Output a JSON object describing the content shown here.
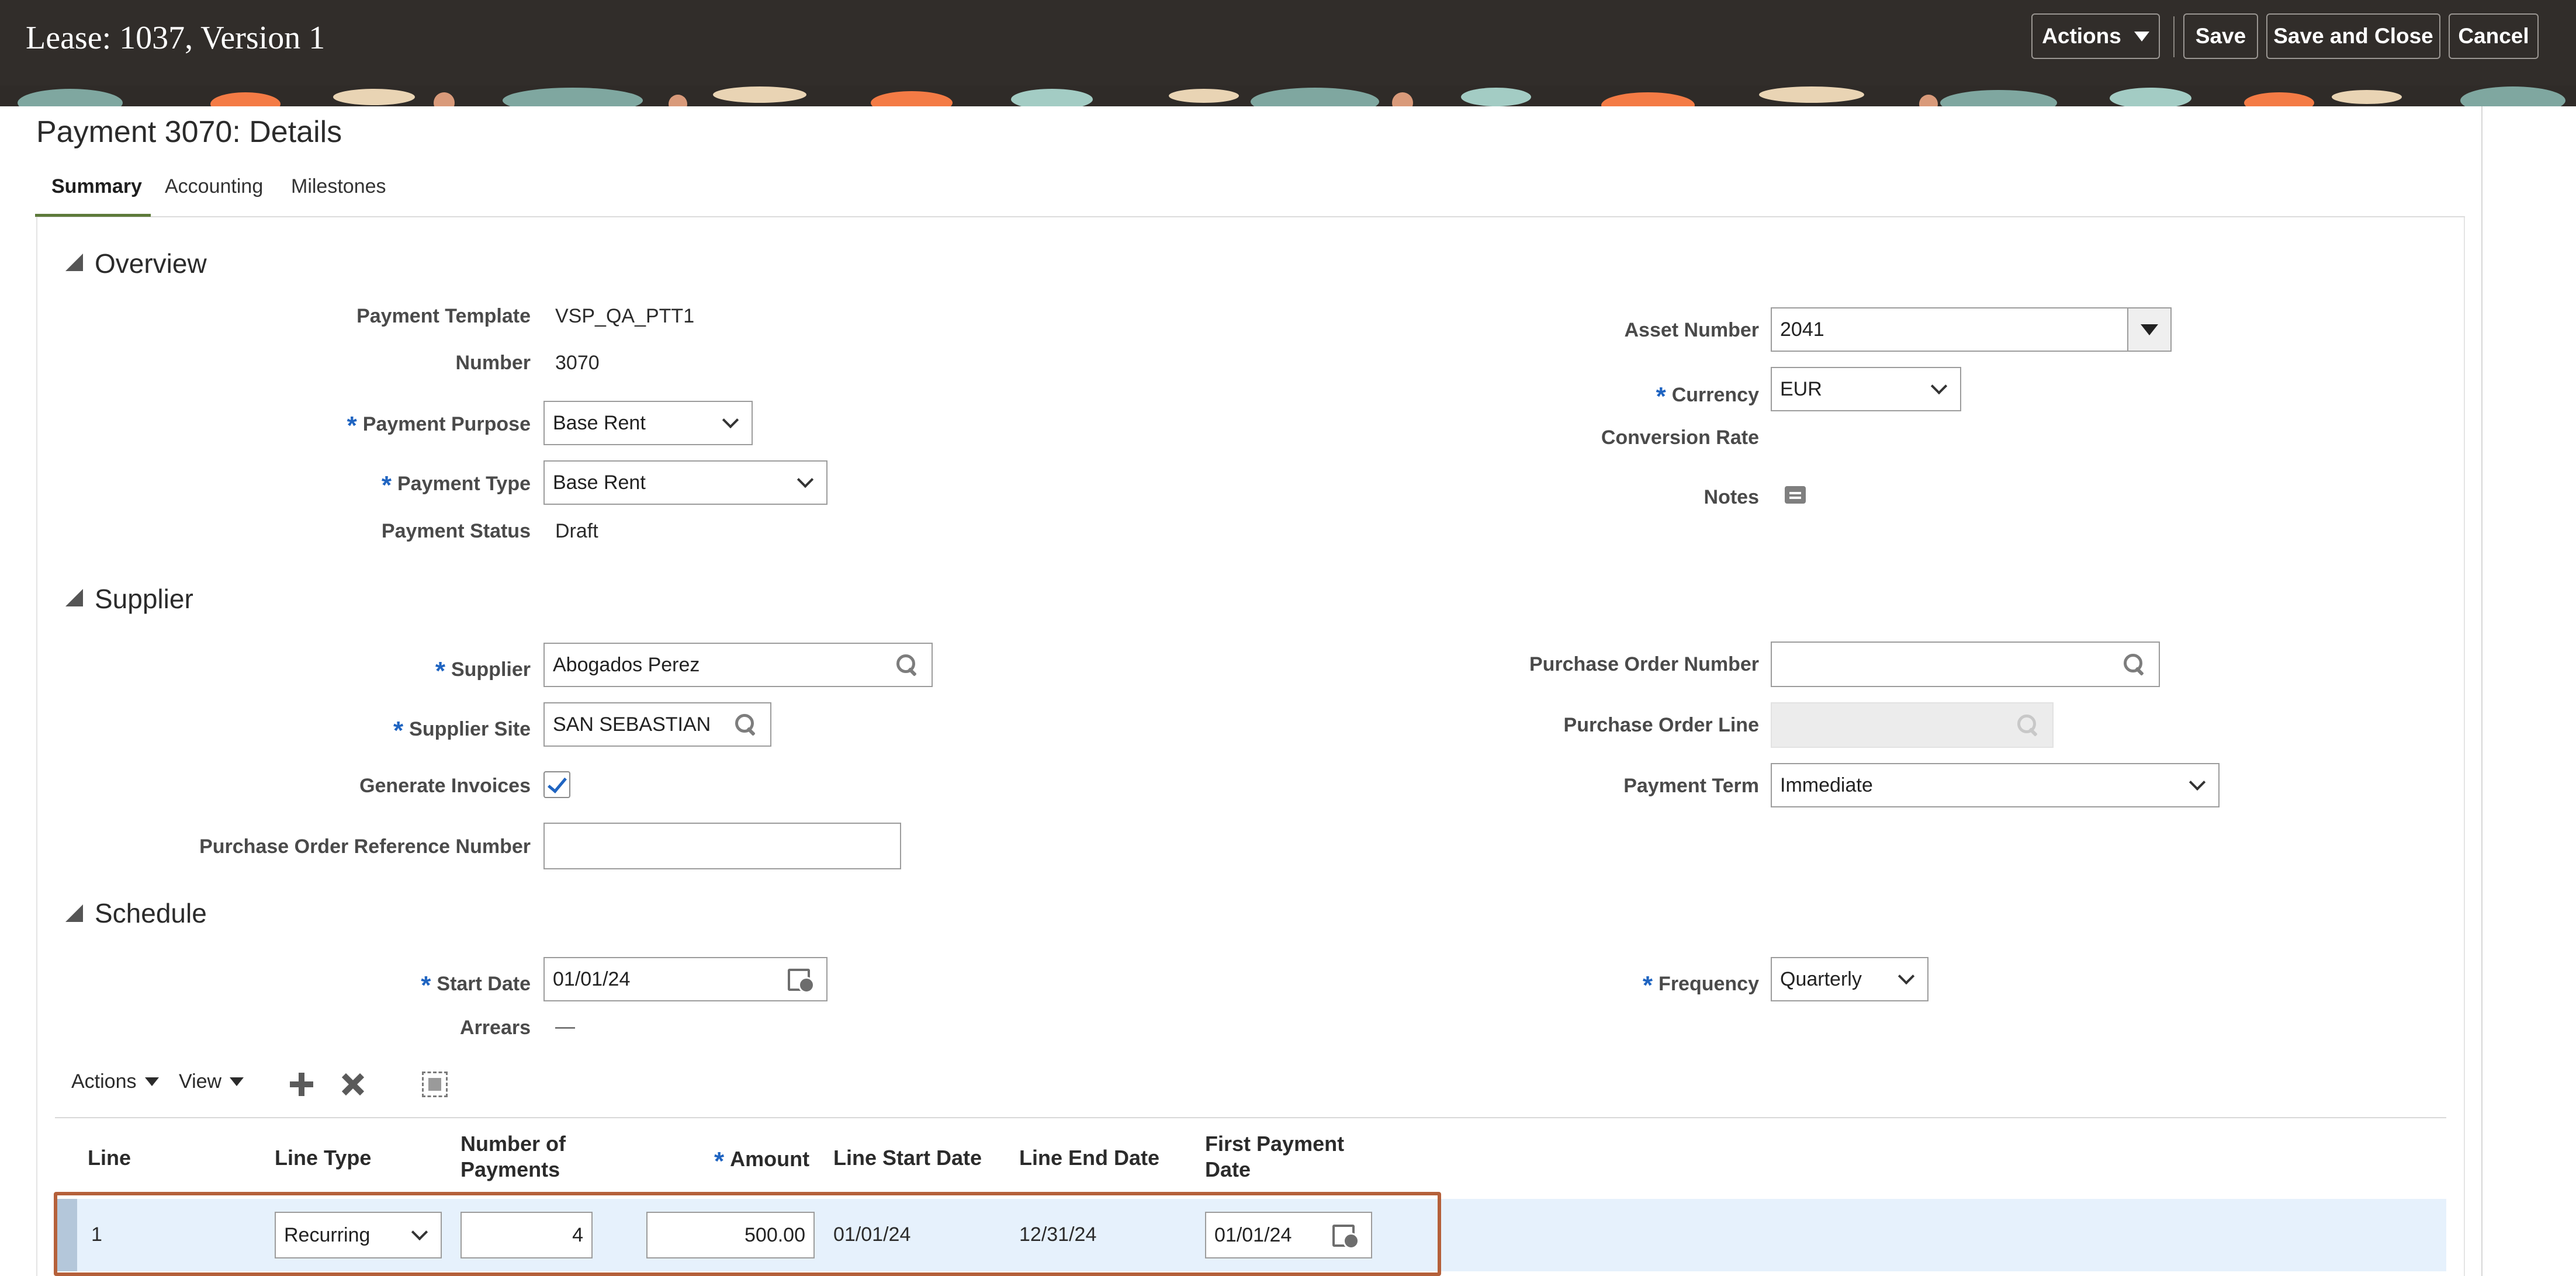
{
  "header": {
    "title": "Lease: 1037, Version 1",
    "actions_label": "Actions",
    "save_label": "Save",
    "save_close_label": "Save and Close",
    "cancel_label": "Cancel"
  },
  "page": {
    "title": "Payment 3070: Details",
    "tabs": [
      {
        "label": "Summary",
        "active": true
      },
      {
        "label": "Accounting",
        "active": false
      },
      {
        "label": "Milestones",
        "active": false
      }
    ]
  },
  "overview": {
    "title": "Overview",
    "payment_template": {
      "label": "Payment Template",
      "value": "VSP_QA_PTT1"
    },
    "number": {
      "label": "Number",
      "value": "3070"
    },
    "payment_purpose": {
      "label": "Payment Purpose",
      "value": "Base Rent",
      "required": true
    },
    "payment_type": {
      "label": "Payment Type",
      "value": "Base Rent",
      "required": true
    },
    "payment_status": {
      "label": "Payment Status",
      "value": "Draft"
    },
    "asset_number": {
      "label": "Asset Number",
      "value": "2041"
    },
    "currency": {
      "label": "Currency",
      "value": "EUR",
      "required": true
    },
    "conversion_rate": {
      "label": "Conversion Rate",
      "value": ""
    },
    "notes": {
      "label": "Notes"
    }
  },
  "supplier": {
    "title": "Supplier",
    "supplier": {
      "label": "Supplier",
      "value": "Abogados Perez",
      "required": true
    },
    "supplier_site": {
      "label": "Supplier Site",
      "value": "SAN SEBASTIAN",
      "required": true
    },
    "generate_invoices": {
      "label": "Generate Invoices",
      "checked": true
    },
    "po_reference_number": {
      "label": "Purchase Order Reference Number",
      "value": ""
    },
    "po_number": {
      "label": "Purchase Order Number",
      "value": ""
    },
    "po_line": {
      "label": "Purchase Order Line",
      "value": ""
    },
    "payment_term": {
      "label": "Payment Term",
      "value": "Immediate"
    }
  },
  "schedule": {
    "title": "Schedule",
    "start_date": {
      "label": "Start Date",
      "value": "01/01/24",
      "required": true
    },
    "arrears": {
      "label": "Arrears",
      "value": "—"
    },
    "frequency": {
      "label": "Frequency",
      "value": "Quarterly",
      "required": true
    }
  },
  "table": {
    "toolbar": {
      "actions_label": "Actions",
      "view_label": "View"
    },
    "columns": {
      "line": "Line",
      "line_type": "Line Type",
      "number_of_payments_1": "Number of",
      "number_of_payments_2": "Payments",
      "amount": "Amount",
      "line_start_date": "Line Start Date",
      "line_end_date": "Line End Date",
      "first_payment_date_1": "First Payment",
      "first_payment_date_2": "Date"
    },
    "rows": [
      {
        "line": "1",
        "line_type": "Recurring",
        "number_of_payments": "4",
        "amount": "500.00",
        "line_start_date": "01/01/24",
        "line_end_date": "12/31/24",
        "first_payment_date": "01/01/24"
      }
    ]
  },
  "colors": {
    "header_bg": "#312d2a",
    "required_marker": "#1f64c1",
    "tab_indicator": "#5d7a3a",
    "selected_row": "#e6f1fc",
    "highlight_border": "#b5603a"
  }
}
